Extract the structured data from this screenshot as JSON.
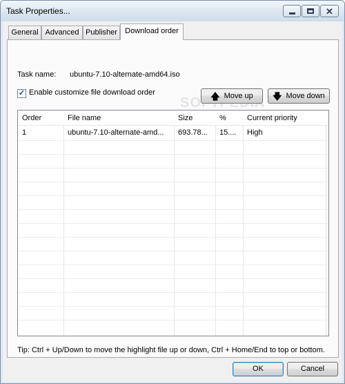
{
  "window": {
    "title": "Task Properties..."
  },
  "tabs": [
    {
      "label": "General"
    },
    {
      "label": "Advanced"
    },
    {
      "label": "Publisher"
    },
    {
      "label": "Download order"
    }
  ],
  "task": {
    "name_label": "Task name:",
    "name_value": "ubuntu-7.10-alternate-amd64.iso"
  },
  "options": {
    "enable_label": "Enable customize file download order",
    "enable_checked": true
  },
  "buttons": {
    "move_up": "Move up",
    "move_down": "Move down",
    "ok": "OK",
    "cancel": "Cancel"
  },
  "list": {
    "columns": [
      "Order",
      "File name",
      "Size",
      "%",
      "Current priority"
    ],
    "rows": [
      {
        "order": "1",
        "file_name": "ubuntu-7.10-alternate-amd...",
        "size": "693.78...",
        "percent": "15....",
        "priority": "High"
      }
    ]
  },
  "tip": "Tip: Ctrl + Up/Down to move the highlight file up or down, Ctrl + Home/End to top or bottom.",
  "watermark": "SOFTPEDIA"
}
